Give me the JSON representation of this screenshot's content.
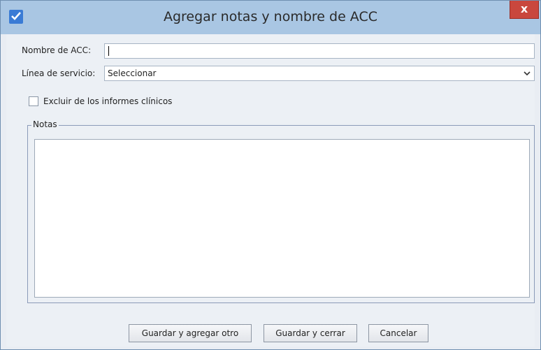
{
  "window": {
    "title": "Agregar notas y nombre de ACC",
    "close_label": "x",
    "accent_color": "#3a7bd5",
    "titlebar_color": "#a9c6e3",
    "close_color": "#c9473d"
  },
  "form": {
    "acc_name": {
      "label": "Nombre de ACC:",
      "value": ""
    },
    "service_line": {
      "label": "Línea de servicio:",
      "selected": "Seleccionar"
    },
    "exclude_checkbox": {
      "label": "Excluir de los informes clínicos",
      "checked": false
    },
    "notes": {
      "legend": "Notas",
      "value": ""
    }
  },
  "buttons": {
    "save_add": "Guardar y agregar otro",
    "save_close": "Guardar y cerrar",
    "cancel": "Cancelar"
  }
}
